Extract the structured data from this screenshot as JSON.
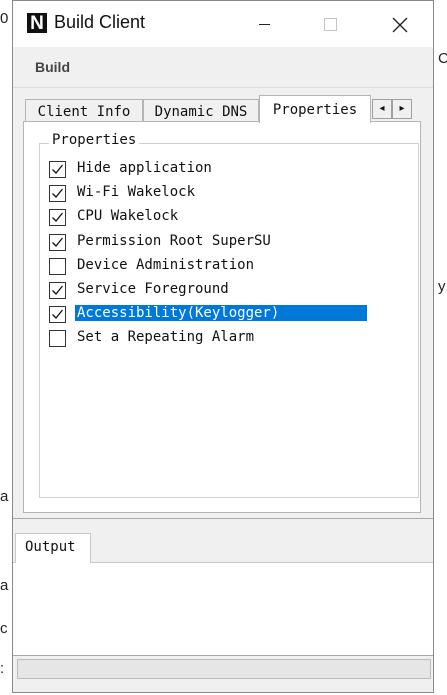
{
  "window": {
    "title": "Build Client",
    "logo_letter": "N"
  },
  "menu": {
    "build_label": "Build"
  },
  "tabs": [
    {
      "label": "Client Info",
      "active": false
    },
    {
      "label": "Dynamic DNS",
      "active": false
    },
    {
      "label": "Properties",
      "active": true
    }
  ],
  "tab_scroll": {
    "left_glyph": "◂",
    "right_glyph": "▸"
  },
  "properties": {
    "group_title": "Properties",
    "options": [
      {
        "label": "Hide application",
        "checked": true,
        "selected": false
      },
      {
        "label": "Wi-Fi Wakelock",
        "checked": true,
        "selected": false
      },
      {
        "label": "CPU Wakelock",
        "checked": true,
        "selected": false
      },
      {
        "label": "Permission Root SuperSU",
        "checked": true,
        "selected": false
      },
      {
        "label": "Device Administration",
        "checked": false,
        "selected": false
      },
      {
        "label": "Service Foreground",
        "checked": true,
        "selected": false
      },
      {
        "label": "Accessibility(Keylogger)",
        "checked": true,
        "selected": true
      },
      {
        "label": "Set a Repeating Alarm",
        "checked": false,
        "selected": false
      }
    ]
  },
  "output": {
    "tab_label": "Output",
    "content": ""
  },
  "progress": {
    "value_percent": 0
  },
  "background_fragments": {
    "top_left": "0",
    "mid_left_1": "a",
    "mid_left_2": "a",
    "mid_left_3": "c",
    "mid_left_4": ":",
    "right_1": "C",
    "right_2": "y"
  },
  "colors": {
    "selection": "#0078d7",
    "window_bg": "#f0f0f0"
  }
}
